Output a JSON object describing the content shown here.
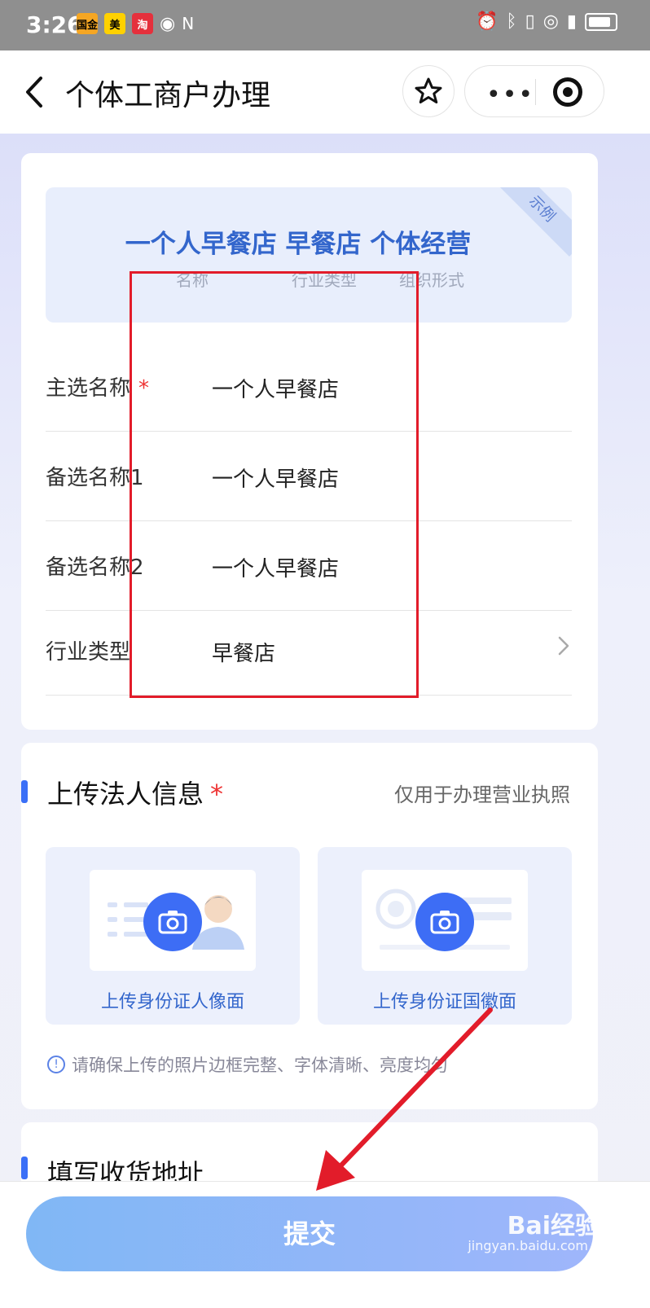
{
  "status_bar": {
    "time": "3:26",
    "app_badges": [
      "国金",
      "美",
      "淘"
    ]
  },
  "header": {
    "title": "个体工商户办理"
  },
  "example_card": {
    "main_text": "一个人早餐店 早餐店 个体经营",
    "sub_labels": [
      "名称",
      "行业类型",
      "组织形式"
    ],
    "ribbon": "示例"
  },
  "form": {
    "rows": [
      {
        "label": "主选名称",
        "required": "*",
        "value": "一个人早餐店"
      },
      {
        "label": "备选名称1",
        "value": "一个人早餐店"
      },
      {
        "label": "备选名称2",
        "value": "一个人早餐店"
      },
      {
        "label": "行业类型",
        "value": "早餐店"
      }
    ]
  },
  "legal_section": {
    "title": "上传法人信息",
    "required": "*",
    "note": "仅用于办理营业执照",
    "upload_front": "上传身份证人像面",
    "upload_back": "上传身份证国徽面",
    "tip": "请确保上传的照片边框完整、字体清晰、亮度均匀"
  },
  "address_section": {
    "title": "填写收货地址"
  },
  "submit_button": {
    "label": "提交"
  },
  "watermark": {
    "text": "Bai经验",
    "sub": "jingyan.baidu.com"
  },
  "colors": {
    "accent": "#3d6df5",
    "annotation": "#e21c2a"
  }
}
